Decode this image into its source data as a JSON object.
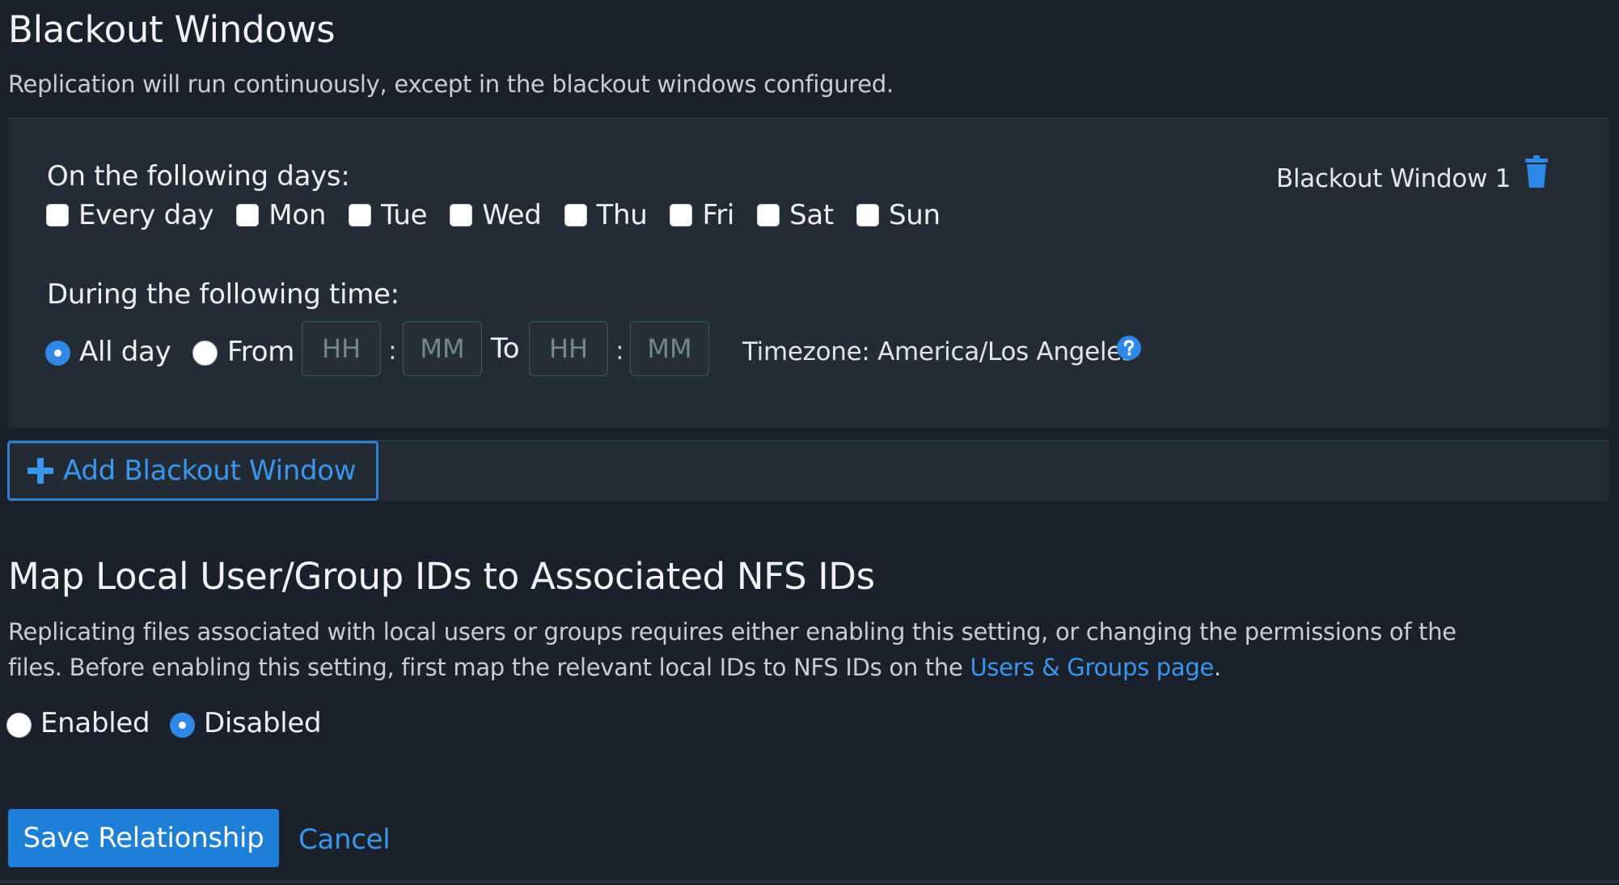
{
  "blackout": {
    "title": "Blackout Windows",
    "description": "Replication will run continuously, except in the blackout windows configured.",
    "window": {
      "name": "Blackout Window 1",
      "days_label": "On the following days:",
      "days": [
        "Every day",
        "Mon",
        "Tue",
        "Wed",
        "Thu",
        "Fri",
        "Sat",
        "Sun"
      ],
      "time_label": "During the following time:",
      "all_day_label": "All day",
      "from_label": "From",
      "to_label": "To",
      "colon": ":",
      "time_selected": "All day",
      "hh_placeholder": "HH",
      "mm_placeholder": "MM",
      "timezone": "Timezone: America/Los Angeles"
    },
    "add_label": "Add Blackout Window"
  },
  "nfs": {
    "title": "Map Local User/Group IDs to Associated NFS IDs",
    "line1": "Replicating files associated with local users or groups requires either enabling this setting, or changing the permissions of the",
    "line2_prefix": "files. Before enabling this setting, first map the relevant local IDs to NFS IDs on the ",
    "link": "Users & Groups page",
    "line2_suffix": ".",
    "enabled_label": "Enabled",
    "disabled_label": "Disabled",
    "selected": "Disabled"
  },
  "actions": {
    "save": "Save Relationship",
    "cancel": "Cancel"
  },
  "colors": {
    "background": "#1b212a",
    "panel": "#232b35",
    "accent": "#2f88e6",
    "link": "#3a96ee",
    "primary_button": "#1d7fd6"
  },
  "icons": {
    "delete": "trash-icon",
    "help": "question-circle-icon",
    "add": "plus-icon"
  }
}
